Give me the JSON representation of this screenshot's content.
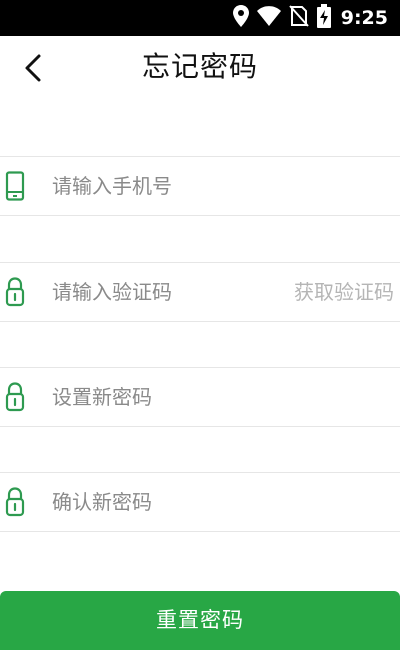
{
  "status_bar": {
    "time": "9:25",
    "icons": [
      "location-icon",
      "wifi-icon",
      "no-sim-icon",
      "battery-charging-icon"
    ]
  },
  "header": {
    "title": "忘记密码",
    "back_icon": "chevron-left-icon"
  },
  "form": {
    "phone": {
      "placeholder": "请输入手机号",
      "value": "",
      "icon": "phone-icon"
    },
    "code": {
      "placeholder": "请输入验证码",
      "value": "",
      "icon": "lock-icon",
      "action_label": "获取验证码"
    },
    "new_password": {
      "placeholder": "设置新密码",
      "value": "",
      "icon": "lock-icon"
    },
    "confirm_password": {
      "placeholder": "确认新密码",
      "value": "",
      "icon": "lock-icon"
    }
  },
  "submit": {
    "label": "重置密码"
  },
  "colors": {
    "accent": "#28a745",
    "icon_green": "#2e9a50",
    "placeholder": "#8a8a8a",
    "disabled_text": "#b5b5b5",
    "divider": "#e6e6e6"
  }
}
